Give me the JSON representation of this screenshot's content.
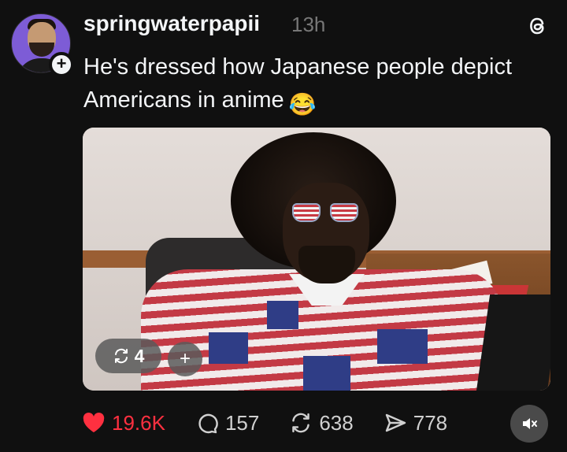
{
  "post": {
    "username": "springwaterpapii",
    "time": "13h",
    "caption": "He's dressed how Japanese people depict Americans in anime",
    "caption_emoji": "😂",
    "media": {
      "repost_count": "4"
    },
    "stats": {
      "likes": "19.6K",
      "replies": "157",
      "reposts": "638",
      "shares": "778"
    },
    "liked": true
  },
  "colors": {
    "background": "#101010",
    "text": "#f3f5f7",
    "muted": "#777777",
    "like": "#ff3040"
  },
  "icons": [
    "threads-logo-icon",
    "plus-icon",
    "heart-icon",
    "comment-icon",
    "repost-icon",
    "share-icon",
    "mute-icon"
  ]
}
